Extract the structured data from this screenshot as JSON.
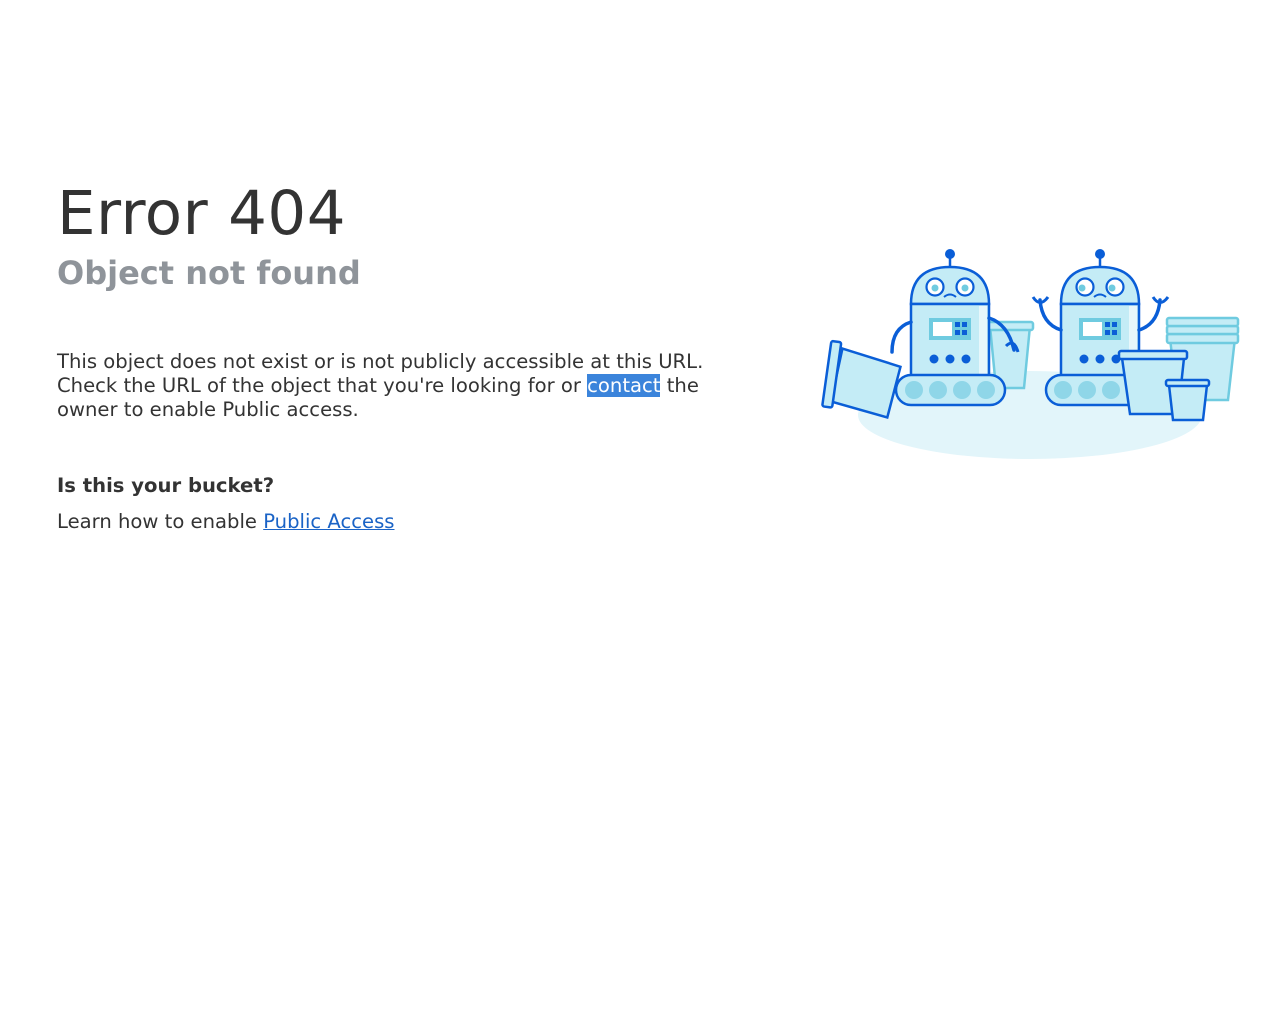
{
  "error": {
    "title": "Error 404",
    "subtitle": "Object not found"
  },
  "message": {
    "part1": "This object does not exist or is not publicly accessible at this URL. Check the URL of the object that you're looking for or ",
    "link_text": "contact",
    "part2": " the owner to enable Public access."
  },
  "bucket": {
    "heading": "Is this your bucket?",
    "text": "Learn how to enable ",
    "link_text": "Public Access"
  },
  "colors": {
    "title": "#333333",
    "subtitle": "#8f949a",
    "link": "#1a63c6",
    "selection": "#3b84db",
    "robot_outline": "#0a5ed7",
    "robot_fill": "#c4ecf6",
    "shadow": "#e2f5fa"
  },
  "illustration": {
    "name": "robots-with-buckets-illustration"
  }
}
